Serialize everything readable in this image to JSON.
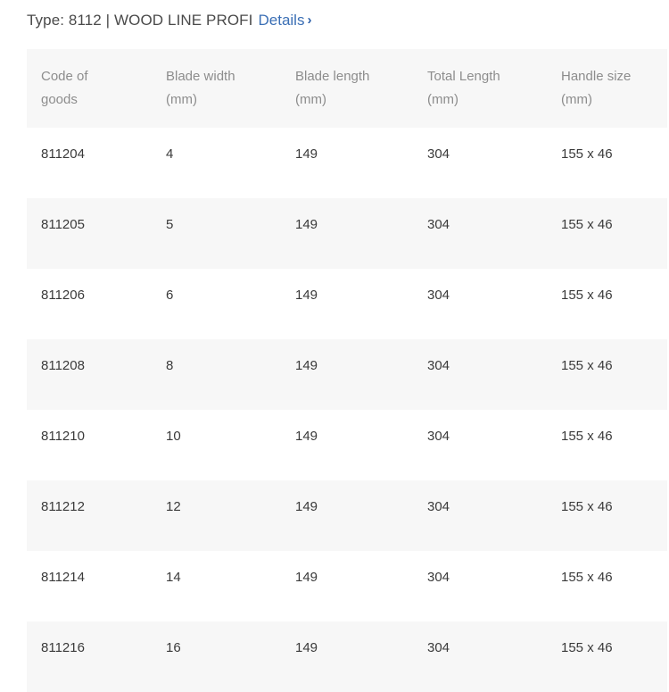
{
  "header": {
    "title_text": "Type: 8112 | WOOD LINE PROFI",
    "details_label": "Details",
    "details_chevron": "›",
    "link_color": "#3b6fb5",
    "title_color": "#4a4a4a"
  },
  "table": {
    "columns": [
      {
        "line1": "Code of",
        "line2": "goods"
      },
      {
        "line1": "Blade width",
        "line2": "(mm)"
      },
      {
        "line1": "Blade length",
        "line2": "(mm)"
      },
      {
        "line1": "Total Length",
        "line2": "(mm)"
      },
      {
        "line1": "Handle size",
        "line2": "(mm)"
      }
    ],
    "header_bg": "#f7f7f7",
    "header_text_color": "#8d8d8d",
    "stripe_bg": "#f7f7f7",
    "row_bg": "#ffffff",
    "rows": [
      {
        "code": "811204",
        "blade_width": "4",
        "blade_length": "149",
        "total_length": "304",
        "handle_size": "155 x 46"
      },
      {
        "code": "811205",
        "blade_width": "5",
        "blade_length": "149",
        "total_length": "304",
        "handle_size": "155 x 46"
      },
      {
        "code": "811206",
        "blade_width": "6",
        "blade_length": "149",
        "total_length": "304",
        "handle_size": "155 x 46"
      },
      {
        "code": "811208",
        "blade_width": "8",
        "blade_length": "149",
        "total_length": "304",
        "handle_size": "155 x 46"
      },
      {
        "code": "811210",
        "blade_width": "10",
        "blade_length": "149",
        "total_length": "304",
        "handle_size": "155 x 46"
      },
      {
        "code": "811212",
        "blade_width": "12",
        "blade_length": "149",
        "total_length": "304",
        "handle_size": "155 x 46"
      },
      {
        "code": "811214",
        "blade_width": "14",
        "blade_length": "149",
        "total_length": "304",
        "handle_size": "155 x 46"
      },
      {
        "code": "811216",
        "blade_width": "16",
        "blade_length": "149",
        "total_length": "304",
        "handle_size": "155 x 46"
      }
    ]
  }
}
